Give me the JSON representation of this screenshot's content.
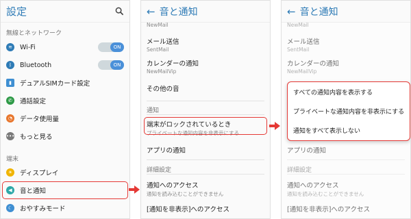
{
  "panel1": {
    "title": "設定",
    "section_network": "無線とネットワーク",
    "section_device": "端末",
    "items": [
      {
        "label": "Wi-Fi",
        "icon": "wifi-icon",
        "color": "#2e7bb6",
        "toggle": "ON"
      },
      {
        "label": "Bluetooth",
        "icon": "bluetooth-icon",
        "color": "#2e7bb6",
        "toggle": "ON"
      },
      {
        "label": "デュアルSIMカード設定",
        "icon": "sim-card-icon",
        "color": "#3f8fd2"
      },
      {
        "label": "通話設定",
        "icon": "phone-icon",
        "color": "#2e9a47"
      },
      {
        "label": "データ使用量",
        "icon": "data-usage-icon",
        "color": "#e8772e"
      },
      {
        "label": "もっと見る",
        "icon": "more-dots-icon",
        "color": "#7a7a7a"
      },
      {
        "label": "ディスプレイ",
        "icon": "brightness-icon",
        "color": "#f0b400"
      },
      {
        "label": "音と通知",
        "icon": "volume-icon",
        "color": "#2ea8a8"
      },
      {
        "label": "おやすみモード",
        "icon": "moon-icon",
        "color": "#3f8fd2"
      }
    ]
  },
  "panel2": {
    "title": "音と通知",
    "partial_sub": "NewMail",
    "items": [
      {
        "title": "メール送信",
        "sub": "SentMail"
      },
      {
        "title": "カレンダーの通知",
        "sub": "NewMailVip"
      },
      {
        "title": "その他の音"
      }
    ],
    "section_notify": "通知",
    "lock_item": {
      "title": "端末がロックされているとき",
      "sub": "プライベートな通知内容を非表示にする"
    },
    "app_notify": "アプリの通知",
    "section_advanced": "詳細設定",
    "access": {
      "title": "通知へのアクセス",
      "sub": "通知を読み込むことができません"
    },
    "hide_access": "[通知を非表示]へのアクセス"
  },
  "panel3": {
    "title": "音と通知",
    "options": [
      "すべての通知内容を表示する",
      "プライベートな通知内容を非表示にする",
      "通知をすべて表示しない"
    ]
  }
}
